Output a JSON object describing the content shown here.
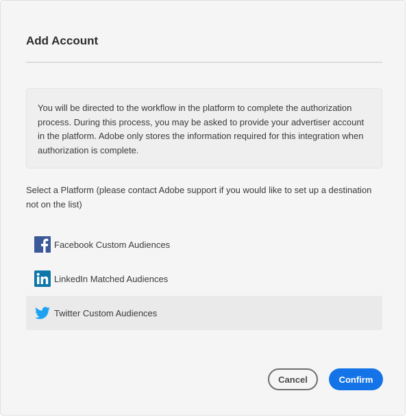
{
  "dialog": {
    "title": "Add Account",
    "info_text": "You will be directed to the workflow in the platform to complete the authorization process. During this process, you may be asked to provide your advertiser account in the platform. Adobe only stores the information required for this integration when authorization is complete.",
    "select_label": "Select a Platform (please contact Adobe support if you would like to set up a destination not on the list)",
    "platforms": [
      {
        "label": "Facebook Custom Audiences",
        "icon": "facebook-icon",
        "color": "#3b5998",
        "selected": false
      },
      {
        "label": "LinkedIn Matched Audiences",
        "icon": "linkedin-icon",
        "color": "#0e76a8",
        "selected": false
      },
      {
        "label": "Twitter Custom Audiences",
        "icon": "twitter-icon",
        "color": "#1da1f2",
        "selected": true
      }
    ],
    "buttons": {
      "cancel_label": "Cancel",
      "confirm_label": "Confirm"
    },
    "colors": {
      "accent": "#1473e6",
      "selected_row": "#eaeaea"
    }
  }
}
